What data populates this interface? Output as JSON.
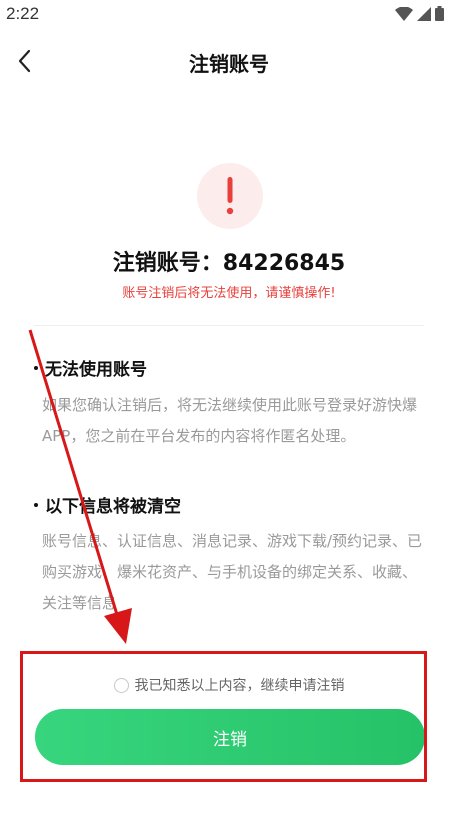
{
  "status_bar": {
    "time": "2:22"
  },
  "nav": {
    "title": "注销账号"
  },
  "account": {
    "label": "注销账号：",
    "number": "84226845",
    "warning": "账号注销后将无法使用，请谨慎操作!"
  },
  "sections": [
    {
      "heading": "无法使用账号",
      "body": "如果您确认注销后，将无法继续使用此账号登录好游快爆APP，您之前在平台发布的内容将作匿名处理。"
    },
    {
      "heading": "以下信息将被清空",
      "body": "账号信息、认证信息、消息记录、游戏下载/预约记录、已购买游戏、爆米花资产、与手机设备的绑定关系、收藏、关注等信息"
    }
  ],
  "agreement": {
    "text": "我已知悉以上内容，继续申请注销"
  },
  "submit": {
    "label": "注销"
  },
  "colors": {
    "accent_green": "#2cc96e",
    "warning_red": "#e8413c",
    "annotation_red": "#d81818"
  }
}
